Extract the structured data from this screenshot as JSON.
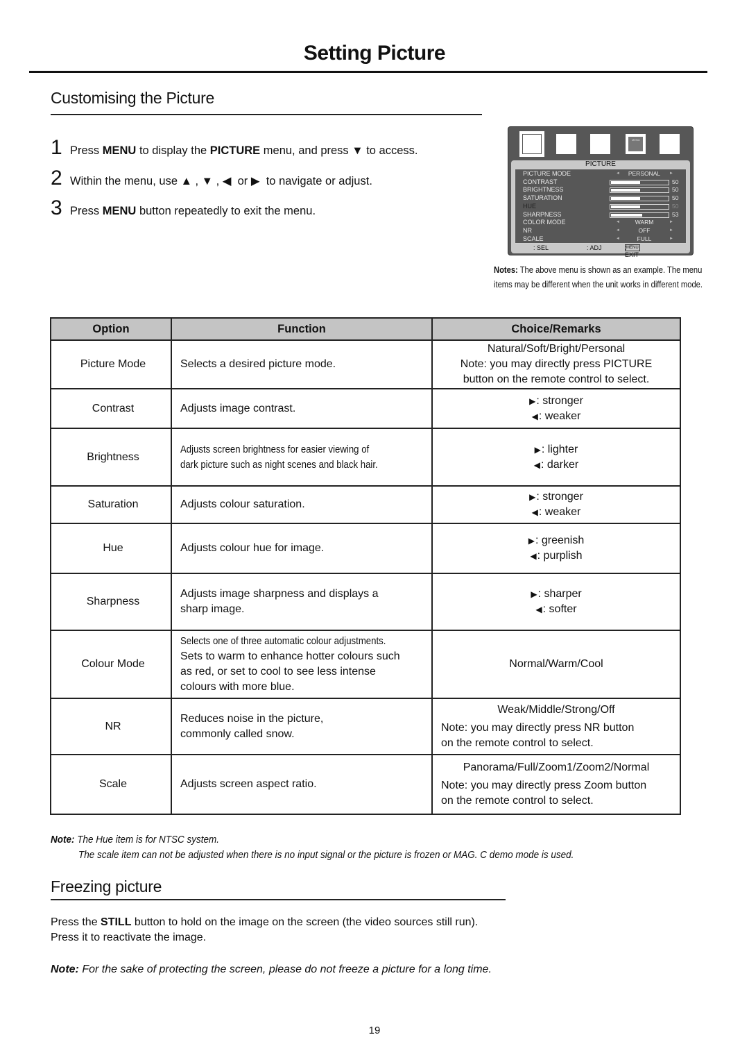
{
  "page": {
    "title": "Setting Picture",
    "number": "19"
  },
  "section1": {
    "title": "Customising the Picture",
    "steps": [
      {
        "num": "1",
        "t1": "Press ",
        "b1": "MENU",
        "t2": " to display the ",
        "b2": "PICTURE",
        "t3": " menu, and press ",
        "icon": "▼",
        "t4": " to access."
      },
      {
        "num": "2",
        "t1": "Within the menu, use ",
        "icons": "▲ , ▼ , ◀  or ▶ ",
        "t2": " to navigate or adjust."
      },
      {
        "num": "3",
        "t1": "Press ",
        "b1": "MENU",
        "t2": " button repeatedly to exit the menu."
      }
    ]
  },
  "osd": {
    "menu_icon_text": "MENU",
    "panel_title": "PICTURE",
    "rows": [
      {
        "label": "PICTURE MODE",
        "type": "select",
        "value": "PERSONAL"
      },
      {
        "label": "CONTRAST",
        "type": "bar",
        "value": 50
      },
      {
        "label": "BRIGHTNESS",
        "type": "bar",
        "value": 50
      },
      {
        "label": "SATURATION",
        "type": "bar",
        "value": 50
      },
      {
        "label": "HUE",
        "type": "bar",
        "value": 50,
        "disabled": true
      },
      {
        "label": "SHARPNESS",
        "type": "bar",
        "value": 53
      },
      {
        "label": "COLOR MODE",
        "type": "select",
        "value": "WARM"
      },
      {
        "label": "NR",
        "type": "select",
        "value": "OFF"
      },
      {
        "label": "SCALE",
        "type": "select",
        "value": "FULL"
      }
    ],
    "status": {
      "sel": ": SEL",
      "adj": ": ADJ",
      "menu_key": "MENU",
      "exit": ": EXIT"
    },
    "arrow_left": "◄",
    "arrow_right": "►"
  },
  "osd_notes": {
    "label": "Notes:",
    "text": " The above menu is shown as an example. The menu items may be different when the unit works in different mode."
  },
  "table": {
    "headers": [
      "Option",
      "Function",
      "Choice/Remarks"
    ],
    "rows": [
      {
        "option": "Picture Mode",
        "function": "Selects a desired picture mode.",
        "choice_lines": [
          "Natural/Soft/Bright/Personal",
          "Note: you may directly press PICTURE",
          "button on the remote control to select."
        ]
      },
      {
        "option": "Contrast",
        "function": "Adjusts image contrast.",
        "right": "stronger",
        "left": "weaker"
      },
      {
        "option": "Brightness",
        "function_lines": [
          "Adjusts screen brightness for easier viewing of",
          "dark picture such as night scenes and black hair."
        ],
        "right": "lighter",
        "left": "darker"
      },
      {
        "option": "Saturation",
        "function": "Adjusts colour saturation.",
        "right": "stronger",
        "left": "weaker"
      },
      {
        "option": "Hue",
        "function": "Adjusts colour hue for image.",
        "right": "greenish",
        "left": "purplish"
      },
      {
        "option": "Sharpness",
        "function_lines": [
          "Adjusts image sharpness and displays a",
          "sharp image."
        ],
        "right": "sharper",
        "left": "softer"
      },
      {
        "option": "Colour Mode",
        "function_small": "Selects one of three automatic colour adjustments.",
        "function_lines": [
          "Sets to warm to enhance hotter colours such",
          "as red, or set to cool to see less intense",
          "colours with more blue."
        ],
        "choice": "Normal/Warm/Cool"
      },
      {
        "option": "NR",
        "function_lines": [
          "Reduces noise in the picture,",
          "commonly called snow."
        ],
        "choice_first": "Weak/Middle/Strong/Off",
        "choice_lines": [
          "Note: you may directly press NR button",
          "on the remote control to select."
        ]
      },
      {
        "option": "Scale",
        "function": "Adjusts screen aspect ratio.",
        "choice_first": "Panorama/Full/Zoom1/Zoom2/Normal",
        "choice_lines": [
          "Note: you may directly press Zoom button",
          "on the remote control to select."
        ]
      }
    ],
    "arrow_right": "▶",
    "arrow_left": "◀",
    "sep": ": "
  },
  "table_notes": {
    "label": "Note:",
    "line1": " The Hue item is for NTSC system.",
    "line2": "The scale item can not be adjusted when there is no input signal or the picture is frozen or MAG. C demo mode is used."
  },
  "section2": {
    "title": "Freezing picture",
    "p1_a": "Press the ",
    "p1_b": "STILL",
    "p1_c": " button to hold on the image on the screen (the video sources still run).",
    "p2": "Press it to reactivate the image.",
    "note_label": "Note:",
    "note_text": " For the sake of protecting the screen, please do not freeze a picture for a long time."
  }
}
